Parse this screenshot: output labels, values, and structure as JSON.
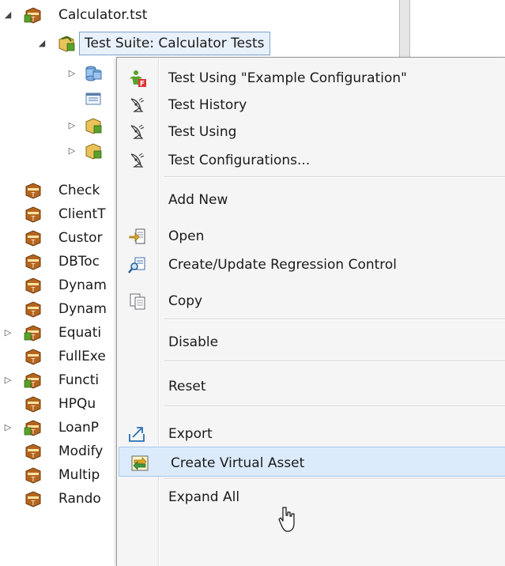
{
  "tree": {
    "root_label": "Calculator.tst",
    "suite_label": "Test Suite: Calculator Tests",
    "items": [
      {
        "label": "Check",
        "expandable": false
      },
      {
        "label": "ClientT",
        "expandable": false
      },
      {
        "label": "Custor",
        "expandable": false
      },
      {
        "label": "DBToc",
        "expandable": false
      },
      {
        "label": "Dynam",
        "expandable": false
      },
      {
        "label": "Dynam",
        "expandable": false
      },
      {
        "label": "Equati",
        "expandable": true
      },
      {
        "label": "FullExe",
        "expandable": false
      },
      {
        "label": "Functi",
        "expandable": true
      },
      {
        "label": "HPQu",
        "expandable": false
      },
      {
        "label": "LoanP",
        "expandable": true
      },
      {
        "label": "Modify",
        "expandable": false
      },
      {
        "label": "Multip",
        "expandable": false
      },
      {
        "label": "Rando",
        "expandable": false
      }
    ]
  },
  "context_menu": {
    "items": [
      {
        "label": "Test Using \"Example Configuration\"",
        "icon": "test-config-icon"
      },
      {
        "label": "Test History",
        "icon": "satellite-dish-icon"
      },
      {
        "label": "Test Using",
        "icon": "satellite-dish-icon"
      },
      {
        "label": "Test Configurations...",
        "icon": "satellite-dish-icon"
      },
      {
        "label": "Add New",
        "icon": ""
      },
      {
        "label": "Open",
        "icon": "open-icon"
      },
      {
        "label": "Create/Update Regression Control",
        "icon": "regression-control-icon"
      },
      {
        "label": "Copy",
        "icon": "copy-icon"
      },
      {
        "label": "Disable",
        "icon": ""
      },
      {
        "label": "Reset",
        "icon": ""
      },
      {
        "label": "Export",
        "icon": "export-icon"
      },
      {
        "label": "Create Virtual Asset",
        "icon": "virtual-asset-icon"
      },
      {
        "label": "Expand All",
        "icon": ""
      }
    ]
  },
  "colors": {
    "highlight_bg": "#dcebfb",
    "highlight_border": "#a5c7ef",
    "menu_bg": "#f5f5f5"
  }
}
